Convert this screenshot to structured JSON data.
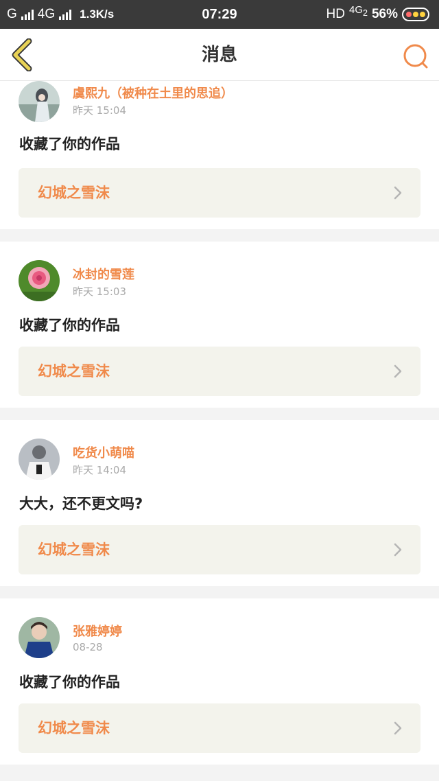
{
  "status_bar": {
    "carrier": "G",
    "network": "4G",
    "speed": "1.3K/s",
    "time": "07:29",
    "hd": "HD",
    "net_type": "4G",
    "net_sub": "2",
    "battery": "56%"
  },
  "nav": {
    "title": "消息",
    "back_icon": "chevron-left-icon",
    "search_icon": "search-icon"
  },
  "colors": {
    "accent": "#f08a4b",
    "back_icon": "#e8d255",
    "status_bar": "#3a3a3a",
    "work_link_bg": "#f3f3ec"
  },
  "messages": [
    {
      "name": "虞熙九（被种在土里的思追）",
      "time": "昨天 15:04",
      "text": "收藏了你的作品",
      "work": "幻城之雪沫"
    },
    {
      "name": "冰封的雪莲",
      "time": "昨天 15:03",
      "text": "收藏了你的作品",
      "work": "幻城之雪沫"
    },
    {
      "name": "吃货小萌喵",
      "time": "昨天 14:04",
      "text": "大大，还不更文吗?",
      "work": "幻城之雪沫"
    },
    {
      "name": "张雅婷婷",
      "time": "08-28",
      "text": "收藏了你的作品",
      "work": "幻城之雪沫"
    }
  ]
}
